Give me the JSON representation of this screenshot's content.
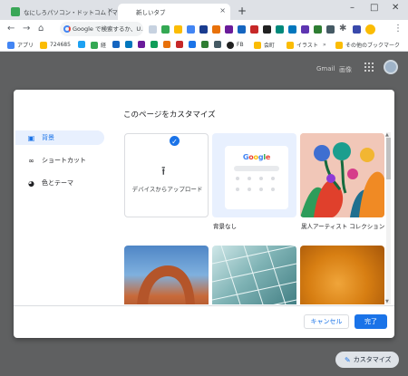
{
  "browser": {
    "tabs": [
      {
        "title": "なにしろパソコン・ドットコム | マルチ仕"
      },
      {
        "title": "新しいタブ"
      }
    ],
    "new_tab_symbol": "+",
    "window_controls": [
      "–",
      "□",
      "✕"
    ],
    "omnibox_text": "Google で検索するか、U...",
    "bookmarks": [
      "アプリ",
      "724685",
      "経",
      "FB",
      "会町",
      "イラスト",
      "その他のブックマーク"
    ]
  },
  "ntp": {
    "gmail_label": "Gmail",
    "images_label": "画像",
    "customize_button": "カスタマイズ"
  },
  "dialog": {
    "title": "このページをカスタマイズ",
    "sidebar": [
      {
        "label": "背景",
        "icon": "background-icon",
        "active": true
      },
      {
        "label": "ショートカット",
        "icon": "link-icon",
        "active": false
      },
      {
        "label": "色とテーマ",
        "icon": "palette-icon",
        "active": false
      }
    ],
    "upload_label": "デバイスからアップロード",
    "mini_google_text": "Google",
    "no_background_label": "背景なし",
    "art_collection_label": "黒人アーティスト コレクション",
    "cancel_label": "キャンセル",
    "done_label": "完了"
  },
  "colors": {
    "accent": "#1a73e8",
    "backdrop": "#5f6061"
  }
}
